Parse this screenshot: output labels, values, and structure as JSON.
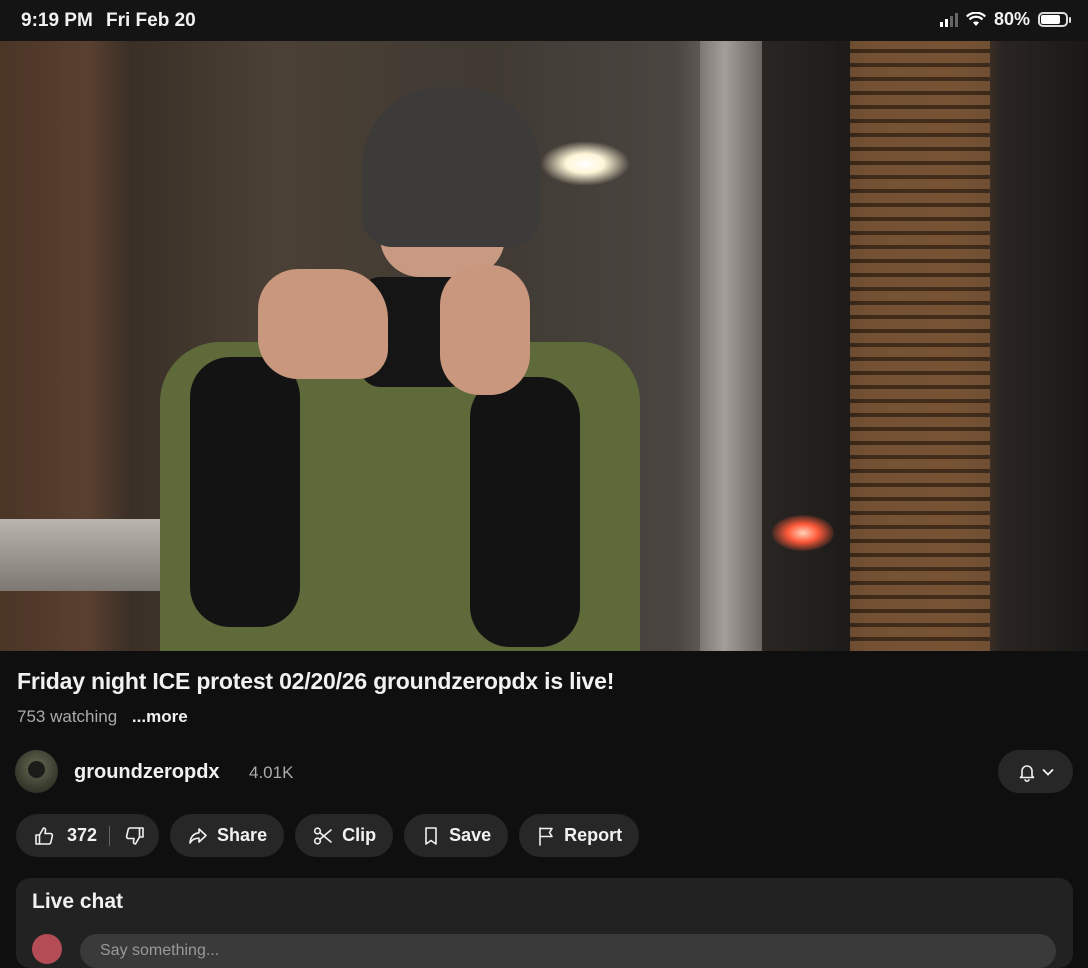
{
  "status_bar": {
    "time": "9:19 PM",
    "date": "Fri Feb 20",
    "battery_percent": "80%",
    "battery_level": 0.8
  },
  "video": {
    "title": "Friday night ICE protest 02/20/26 groundzeropdx is live!",
    "watching": "753 watching",
    "more_label": "...more"
  },
  "channel": {
    "name": "groundzeropdx",
    "subscribers": "4.01K"
  },
  "actions": {
    "likes": "372",
    "share_label": "Share",
    "clip_label": "Clip",
    "save_label": "Save",
    "report_label": "Report"
  },
  "live_chat": {
    "title": "Live chat",
    "input_placeholder": "Say something..."
  },
  "icons": {
    "like": "thumbs-up-icon",
    "dislike": "thumbs-down-icon",
    "share": "share-arrow-icon",
    "clip": "scissors-icon",
    "save": "bookmark-icon",
    "report": "flag-icon",
    "notifications": "bell-icon"
  }
}
